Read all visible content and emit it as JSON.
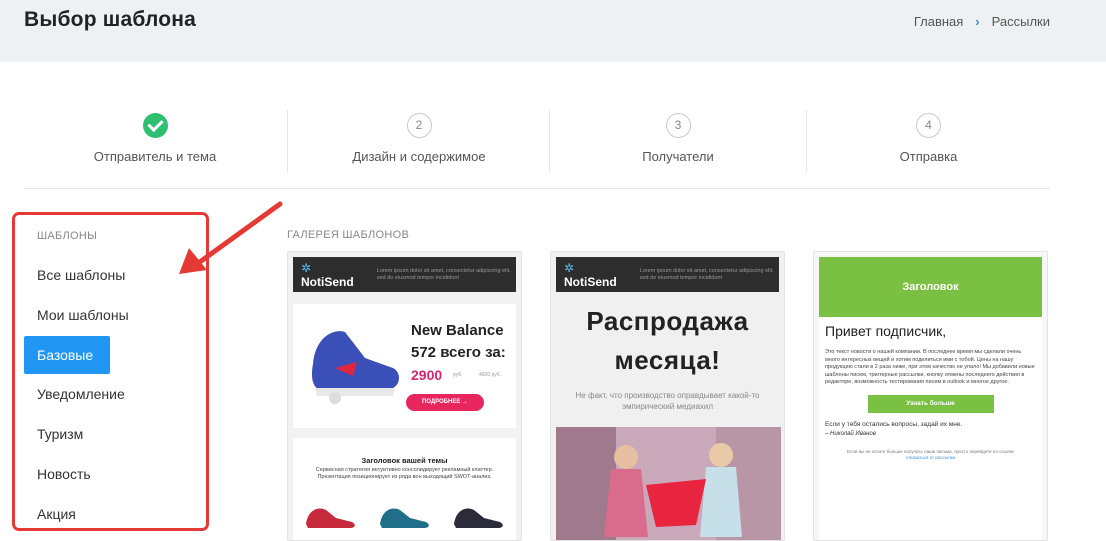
{
  "header": {
    "title": "Выбор шаблона",
    "breadcrumb": [
      "Главная",
      "Рассылки"
    ]
  },
  "steps": [
    {
      "label": "Отправитель и тема",
      "state": "done"
    },
    {
      "number": "2",
      "label": "Дизайн и содержимое"
    },
    {
      "number": "3",
      "label": "Получатели"
    },
    {
      "number": "4",
      "label": "Отправка"
    }
  ],
  "sidebar": {
    "section": "ШАБЛОНЫ",
    "items": [
      {
        "label": "Все шаблоны"
      },
      {
        "label": "Мои шаблоны"
      },
      {
        "label": "Базовые",
        "active": true
      },
      {
        "label": "Уведомление"
      },
      {
        "label": "Туризм"
      },
      {
        "label": "Новость"
      },
      {
        "label": "Акция"
      }
    ]
  },
  "gallery": {
    "title": "ГАЛЕРЕЯ ШАБЛОНОВ",
    "cards": [
      {
        "brand": "NotiSend",
        "header_text": "Lorem ipsum dolor sit amet, consectetur adipiscing elit, sed do eiusmod tempor incididunt",
        "product": "New Balance",
        "price_line": "572 всего за:",
        "price": "2900",
        "price_unit": "руб.",
        "old_price": "4600 руб.",
        "button": "ПОДРОБНЕЕ →",
        "section_title": "Заголовок вашей темы",
        "section_text": "Сервисная стратегия интуитивно консолидирует рекламный клаттер. Презентация позиционирует из ряда вон выходящий SWOT-анализ."
      },
      {
        "brand": "NotiSend",
        "header_text": "Lorem ipsum dolor sit amet, consectetur adipiscing elit, sed do eiusmod tempor incididunt",
        "headline1": "Распродажа",
        "headline2": "месяца!",
        "subtitle": "Не факт, что производство оправдывает какой-то эмпирический медиахил"
      },
      {
        "banner": "Заголовок",
        "greeting": "Привет подписчик,",
        "body": "Это текст новости о нашей компании. В последнее время мы сделали очень много интересных вещей и хотим поделиться ими с тобой. Цены на нашу продукцию стали в 2 раза ниже, при этом качество не упало! Мы добавили новые шаблоны писем, триггерные рассылки, кнопку отмены последнего действия в редакторе, возможность тестирования писем в outlook и многое другое.",
        "button": "Узнать больше",
        "question": "Если у тебя остались вопросы, задай их мне.",
        "signature": "– Николай Иванов",
        "footer": "Если вы не хотите больше получать наши письма, просто перейдите по ссылке",
        "unsubscribe": "отказаться от рассылки"
      }
    ]
  },
  "colors": {
    "accent": "#2196f3",
    "check": "#2fbf71",
    "highlight": "#e53935",
    "green_banner": "#7ac143",
    "price": "#d6246e"
  }
}
